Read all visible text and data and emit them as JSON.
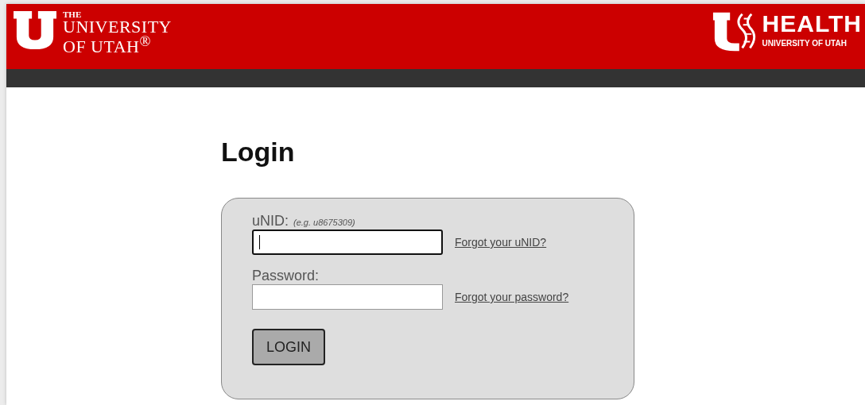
{
  "header": {
    "left_logo": {
      "lines": [
        "THE",
        "UNIVERSITY",
        "OF UTAH$^{®}$"
      ]
    },
    "right_logo": {
      "title": "HEALTH",
      "subtitle": "UNIVERSITY OF UTAH"
    }
  },
  "heading": "Login",
  "form": {
    "fields": [
      {
        "label": "uNID:",
        "hint": "(e.g. u8675309)",
        "focused": true,
        "link": "Forgot your uNID?"
      },
      {
        "label": "Password:",
        "focused": false,
        "link": "Forgot your password?"
      }
    ],
    "button": "LOGIN"
  }
}
